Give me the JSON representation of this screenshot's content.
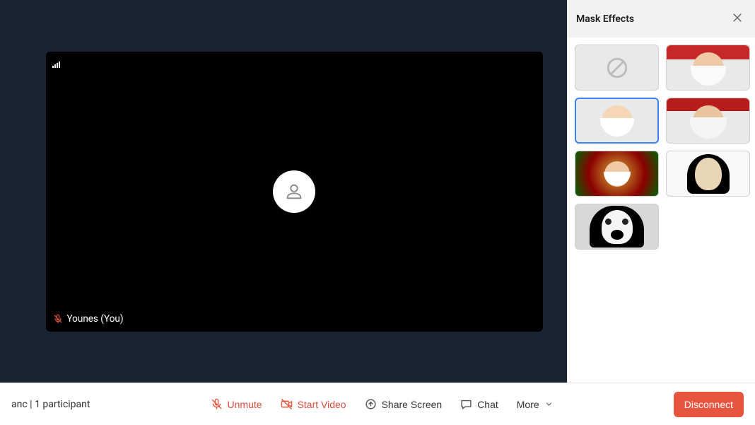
{
  "panel": {
    "title": "Mask Effects"
  },
  "masks": {
    "none_label": "none",
    "items": [
      "none",
      "santa-1",
      "santa-2",
      "santa-3",
      "santa-4",
      "creepy-doll",
      "nun"
    ],
    "selected_index": 2
  },
  "participant": {
    "name_label": "Younes (You)"
  },
  "footer": {
    "room_name": "anc",
    "participant_count_label": "1 participant",
    "unmute": "Unmute",
    "start_video": "Start Video",
    "share_screen": "Share Screen",
    "chat": "Chat",
    "more": "More",
    "disconnect": "Disconnect"
  }
}
